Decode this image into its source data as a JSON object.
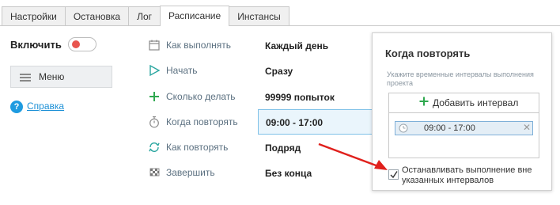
{
  "tabs": [
    "Настройки",
    "Остановка",
    "Лог",
    "Расписание",
    "Инстансы"
  ],
  "active_tab": "Расписание",
  "left": {
    "enable_label": "Включить",
    "toggle_on": false,
    "menu_label": "Меню",
    "help_label": "Справка"
  },
  "rows": [
    {
      "label": "Как выполнять",
      "value": "Каждый день",
      "icon": "calendar-icon"
    },
    {
      "label": "Начать",
      "value": "Сразу",
      "icon": "play-icon"
    },
    {
      "label": "Сколько делать",
      "value": "99999 попыток",
      "icon": "plus-icon"
    },
    {
      "label": "Когда повторять",
      "value": "09:00 - 17:00",
      "icon": "stopwatch-icon"
    },
    {
      "label": "Как повторять",
      "value": "Подряд",
      "icon": "repeat-icon"
    },
    {
      "label": "Завершить",
      "value": "Без конца",
      "icon": "finish-flag-icon"
    }
  ],
  "popup": {
    "title": "Когда повторять",
    "description": "Укажите временные интервалы выполнения проекта",
    "add_interval_label": "Добавить интервал",
    "intervals": [
      {
        "text": "09:00 - 17:00"
      }
    ],
    "checkbox_label": "Останавливать выполнение вне указанных интервалов",
    "checkbox_checked": true
  },
  "colors": {
    "accent": "#1e9be0",
    "toggle_red": "#e8554e",
    "add_green": "#2fa84f",
    "arrow_red": "#e0201c",
    "row_label": "#5b7080"
  }
}
